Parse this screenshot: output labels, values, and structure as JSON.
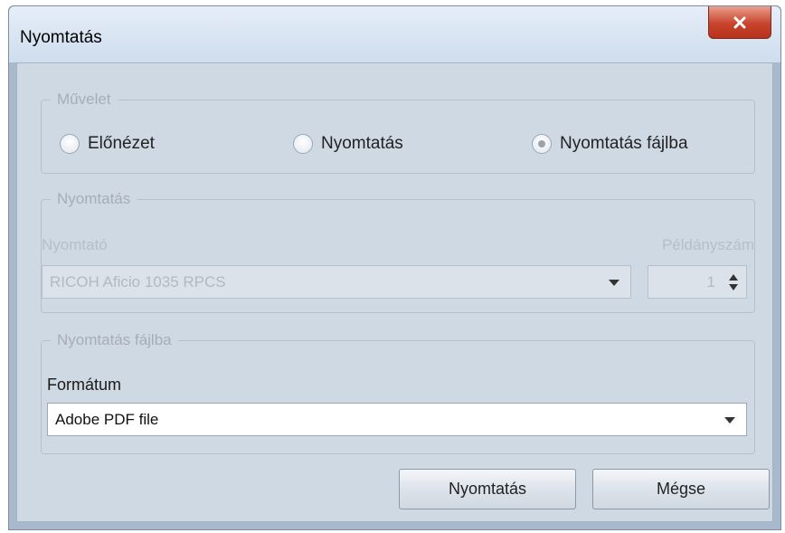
{
  "window": {
    "title": "Nyomtatás"
  },
  "operation_group": {
    "legend": "Művelet",
    "options": [
      {
        "label": "Előnézet",
        "selected": false
      },
      {
        "label": "Nyomtatás",
        "selected": false
      },
      {
        "label": "Nyomtatás fájlba",
        "selected": true
      }
    ]
  },
  "print_group": {
    "legend": "Nyomtatás",
    "printer_label": "Nyomtató",
    "printer_value": "RICOH Aficio 1035 RPCS",
    "copies_label": "Példányszám",
    "copies_value": "1"
  },
  "file_group": {
    "legend": "Nyomtatás fájlba",
    "format_label": "Formátum",
    "format_value": "Adobe PDF file"
  },
  "buttons": {
    "print_label": "Nyomtatás",
    "cancel_label": "Mégse"
  },
  "colors": {
    "window_frame": "#a9b9cc",
    "client_bg": "#cfd9e4",
    "close_button": "#c8432c"
  }
}
